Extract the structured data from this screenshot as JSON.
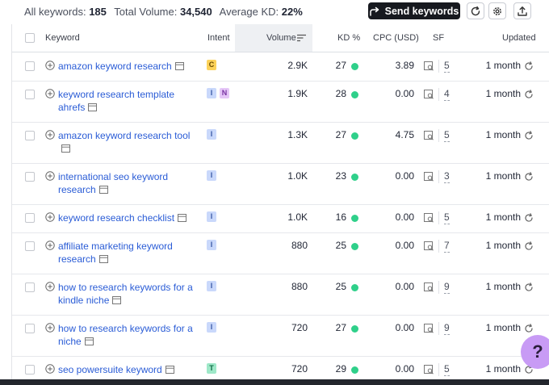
{
  "summary": {
    "all_keywords_label": "All keywords:",
    "all_keywords_value": "185",
    "total_volume_label": "Total Volume:",
    "total_volume_value": "34,540",
    "avg_kd_label": "Average KD:",
    "avg_kd_value": "22%"
  },
  "toolbar": {
    "send_keywords_label": "Send keywords",
    "send_icon": "share-arrow-icon",
    "refresh_icon": "refresh-icon",
    "settings_icon": "gear-icon",
    "export_icon": "upload-icon"
  },
  "table": {
    "headers": {
      "keyword": "Keyword",
      "intent": "Intent",
      "volume": "Volume",
      "kd": "KD %",
      "cpc": "CPC (USD)",
      "sf": "SF",
      "updated": "Updated"
    },
    "rows": [
      {
        "keyword": "amazon keyword research",
        "intent": [
          "C"
        ],
        "volume": "2.9K",
        "kd": "27",
        "cpc": "3.89",
        "sf": "5",
        "updated": "1 month"
      },
      {
        "keyword": "keyword research template ahrefs",
        "intent": [
          "I",
          "N"
        ],
        "volume": "1.9K",
        "kd": "28",
        "cpc": "0.00",
        "sf": "4",
        "updated": "1 month"
      },
      {
        "keyword": "amazon keyword research tool",
        "intent": [
          "I"
        ],
        "volume": "1.3K",
        "kd": "27",
        "cpc": "4.75",
        "sf": "5",
        "updated": "1 month"
      },
      {
        "keyword": "international seo keyword research",
        "intent": [
          "I"
        ],
        "volume": "1.0K",
        "kd": "23",
        "cpc": "0.00",
        "sf": "3",
        "updated": "1 month"
      },
      {
        "keyword": "keyword research checklist",
        "intent": [
          "I"
        ],
        "volume": "1.0K",
        "kd": "16",
        "cpc": "0.00",
        "sf": "5",
        "updated": "1 month"
      },
      {
        "keyword": "affiliate marketing keyword research",
        "intent": [
          "I"
        ],
        "volume": "880",
        "kd": "25",
        "cpc": "0.00",
        "sf": "7",
        "updated": "1 month"
      },
      {
        "keyword": "how to research keywords for a kindle niche",
        "intent": [
          "I"
        ],
        "volume": "880",
        "kd": "25",
        "cpc": "0.00",
        "sf": "9",
        "updated": "1 month"
      },
      {
        "keyword": "how to research keywords for a niche",
        "intent": [
          "I"
        ],
        "volume": "720",
        "kd": "27",
        "cpc": "0.00",
        "sf": "9",
        "updated": "1 month"
      },
      {
        "keyword": "seo powersuite keyword",
        "intent": [
          "T"
        ],
        "volume": "720",
        "kd": "29",
        "cpc": "0.00",
        "sf": "5",
        "updated": "1 month"
      }
    ]
  },
  "help_button": {
    "label": "?"
  },
  "colors": {
    "accent_link": "#2a5cd6",
    "kd_dot": "#2fd08a",
    "help": "#c89bf5"
  }
}
